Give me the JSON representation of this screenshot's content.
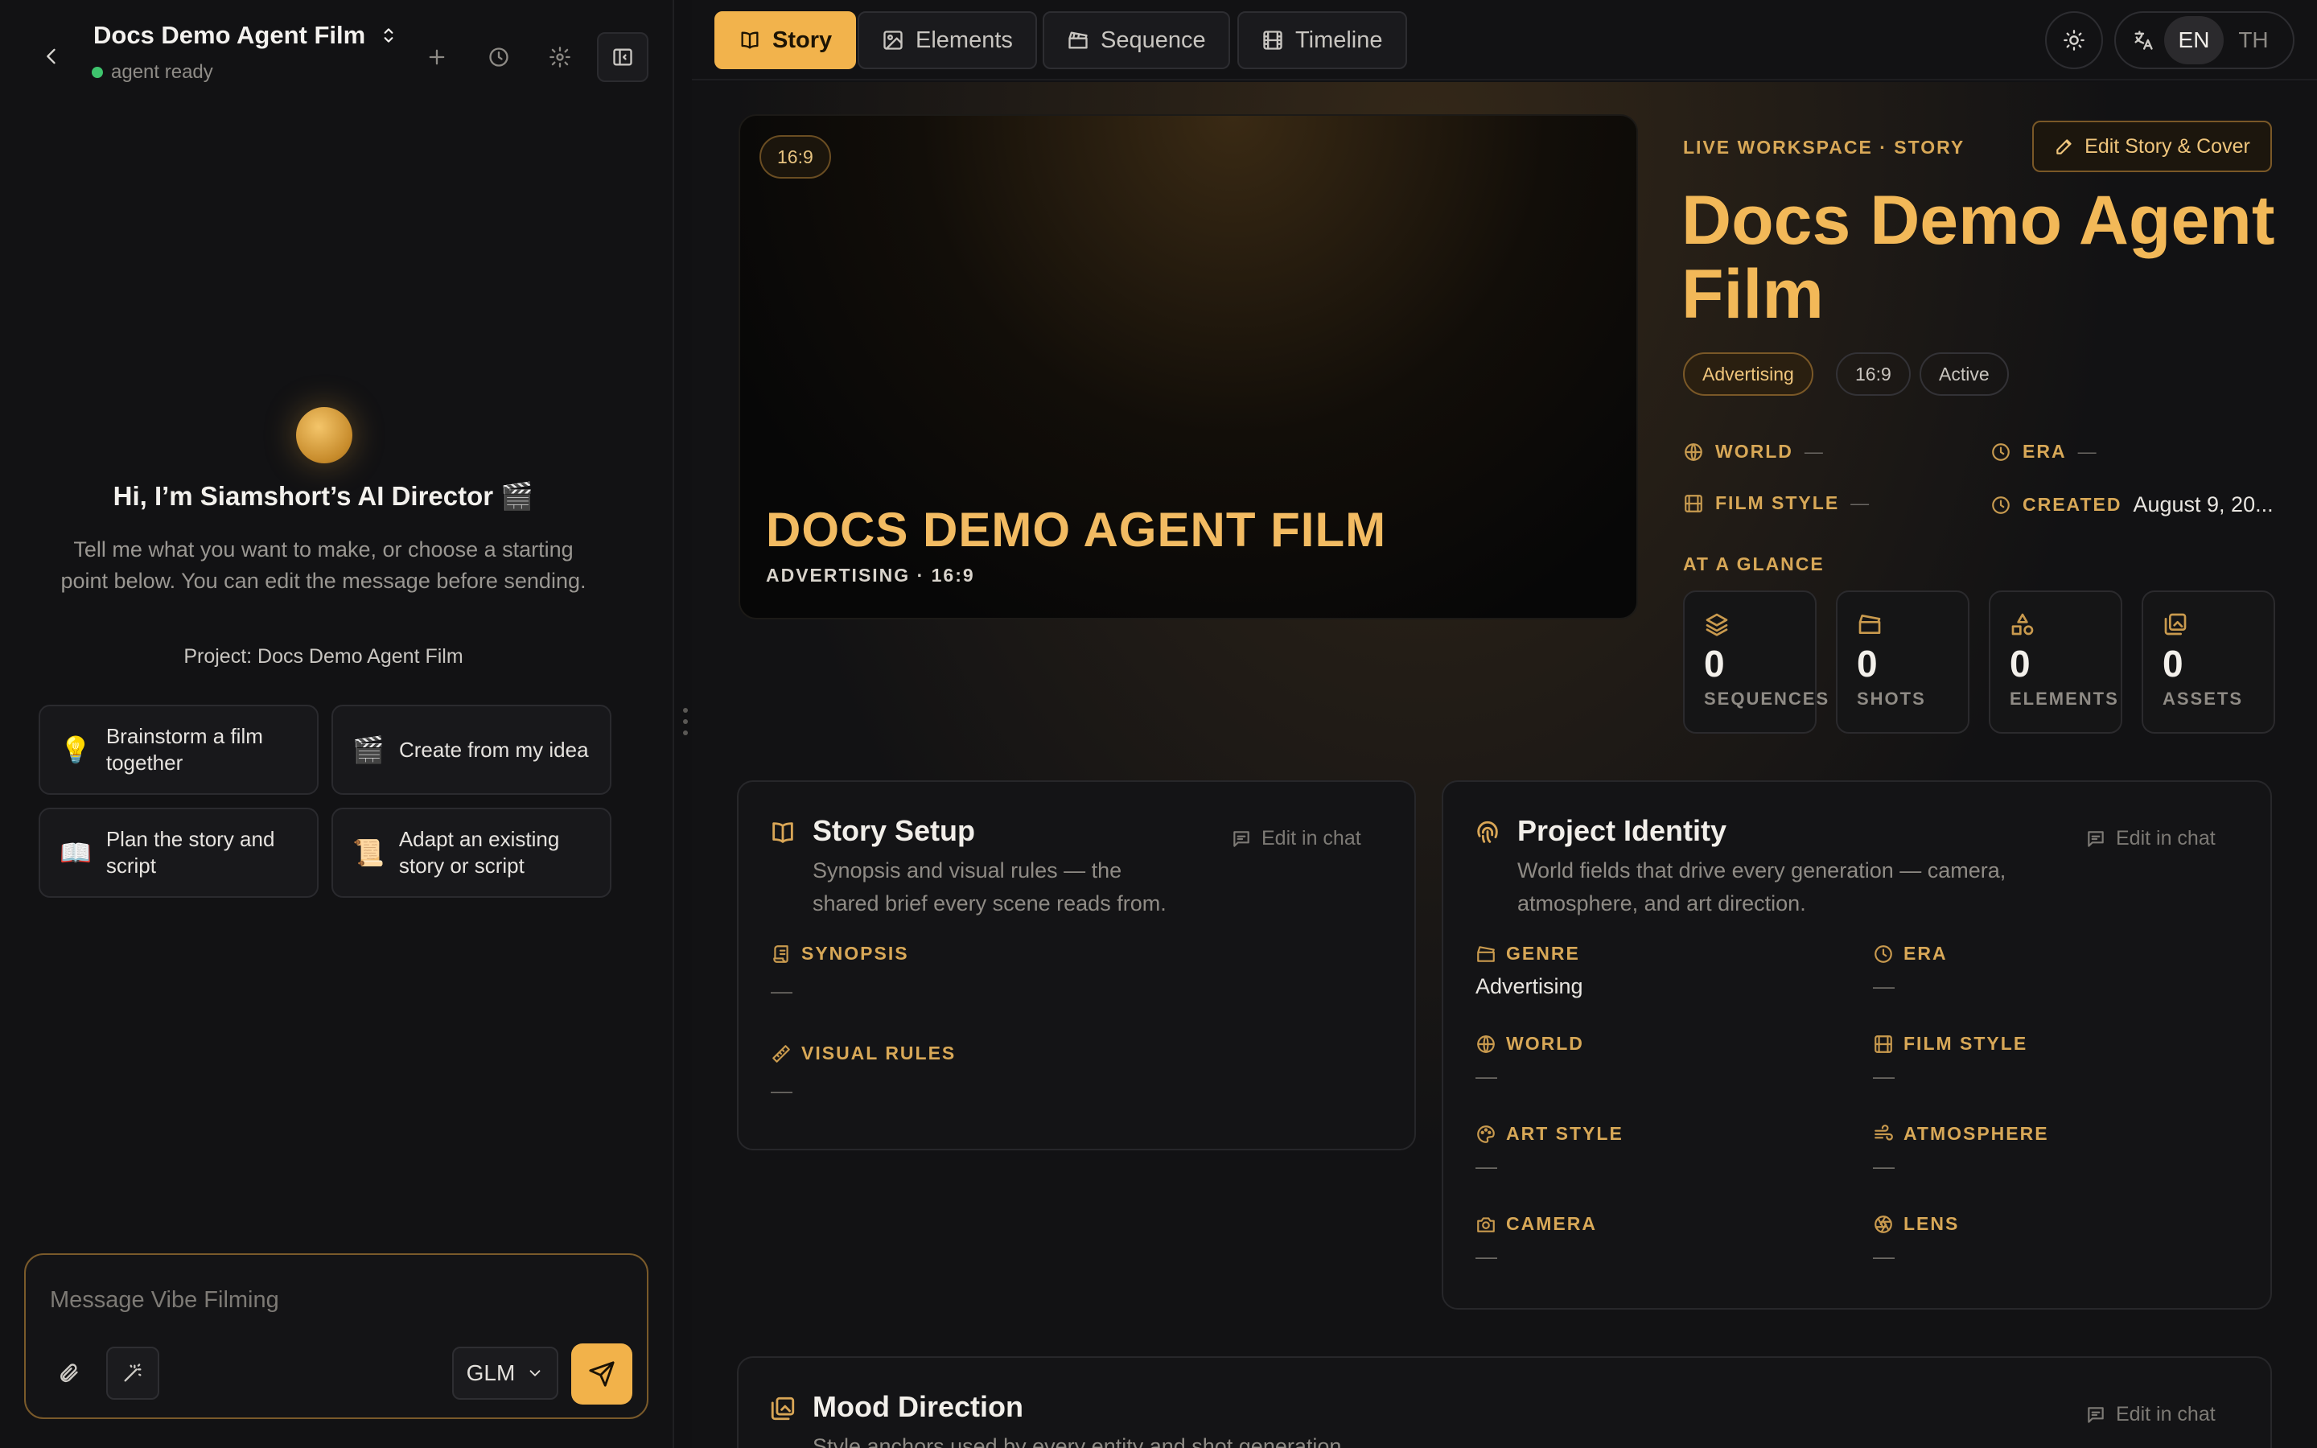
{
  "sidebar": {
    "project_title": "Docs Demo Agent Film",
    "status": "agent ready",
    "greeting": "Hi, I’m Siamshort’s AI Director 🎬",
    "greeting_sub": "Tell me what you want to make, or choose a starting point below. You can edit the message before sending.",
    "project_line": "Project: Docs Demo Agent Film",
    "starters": [
      {
        "emoji": "💡",
        "label": "Brainstorm a film together"
      },
      {
        "emoji": "🎬",
        "label": "Create from my idea"
      },
      {
        "emoji": "📖",
        "label": "Plan the story and script"
      },
      {
        "emoji": "📜",
        "label": "Adapt an existing story or script"
      }
    ],
    "composer": {
      "placeholder": "Message Vibe Filming",
      "model": "GLM"
    }
  },
  "nav": {
    "tabs": [
      {
        "label": "Story",
        "icon": "book-icon",
        "active": true
      },
      {
        "label": "Elements",
        "icon": "image-edit-icon",
        "active": false
      },
      {
        "label": "Sequence",
        "icon": "clapperboard-icon",
        "active": false
      },
      {
        "label": "Timeline",
        "icon": "film-icon",
        "active": false
      }
    ],
    "lang_options": [
      "EN",
      "TH"
    ],
    "lang_selected": "EN"
  },
  "hero": {
    "ratio_badge": "16:9",
    "cover_title": "DOCS DEMO AGENT FILM",
    "cover_meta": "ADVERTISING · 16:9",
    "workspace_label": "LIVE WORKSPACE · STORY",
    "edit_button": "Edit Story & Cover",
    "title": "Docs Demo Agent Film",
    "chips": [
      "Advertising",
      "16:9",
      "Active"
    ],
    "meta": {
      "world_label": "WORLD",
      "world_value": "—",
      "era_label": "ERA",
      "era_value": "—",
      "film_style_label": "FILM STYLE",
      "film_style_value": "—",
      "created_label": "CREATED",
      "created_value": "August 9, 20..."
    },
    "glance_label": "AT A GLANCE",
    "stats": [
      {
        "value": "0",
        "label": "SEQUENCES"
      },
      {
        "value": "0",
        "label": "SHOTS"
      },
      {
        "value": "0",
        "label": "ELEMENTS"
      },
      {
        "value": "0",
        "label": "ASSETS"
      }
    ]
  },
  "story_setup": {
    "title": "Story Setup",
    "subtitle_1": "Synopsis and visual rules — the",
    "subtitle_2": "shared brief every scene reads from.",
    "edit_label": "Edit in chat",
    "synopsis_label": "SYNOPSIS",
    "synopsis_value": "—",
    "visual_rules_label": "VISUAL RULES",
    "visual_rules_value": "—"
  },
  "project_identity": {
    "title": "Project Identity",
    "subtitle_1": "World fields that drive every generation — camera,",
    "subtitle_2": "atmosphere, and art direction.",
    "edit_label": "Edit in chat",
    "fields": {
      "genre_label": "GENRE",
      "genre_value": "Advertising",
      "era_label": "ERA",
      "era_value": "—",
      "world_label": "WORLD",
      "world_value": "—",
      "film_style_label": "FILM STYLE",
      "film_style_value": "—",
      "art_style_label": "ART STYLE",
      "art_style_value": "—",
      "atmosphere_label": "ATMOSPHERE",
      "atmosphere_value": "—",
      "camera_label": "CAMERA",
      "camera_value": "—",
      "lens_label": "LENS",
      "lens_value": "—"
    }
  },
  "mood_direction": {
    "title": "Mood Direction",
    "subtitle": "Style anchors used by every entity and shot generation",
    "edit_label": "Edit in chat"
  },
  "colors": {
    "accent": "#f2b34c",
    "background": "#121214",
    "status_ok": "#3ec46d"
  }
}
